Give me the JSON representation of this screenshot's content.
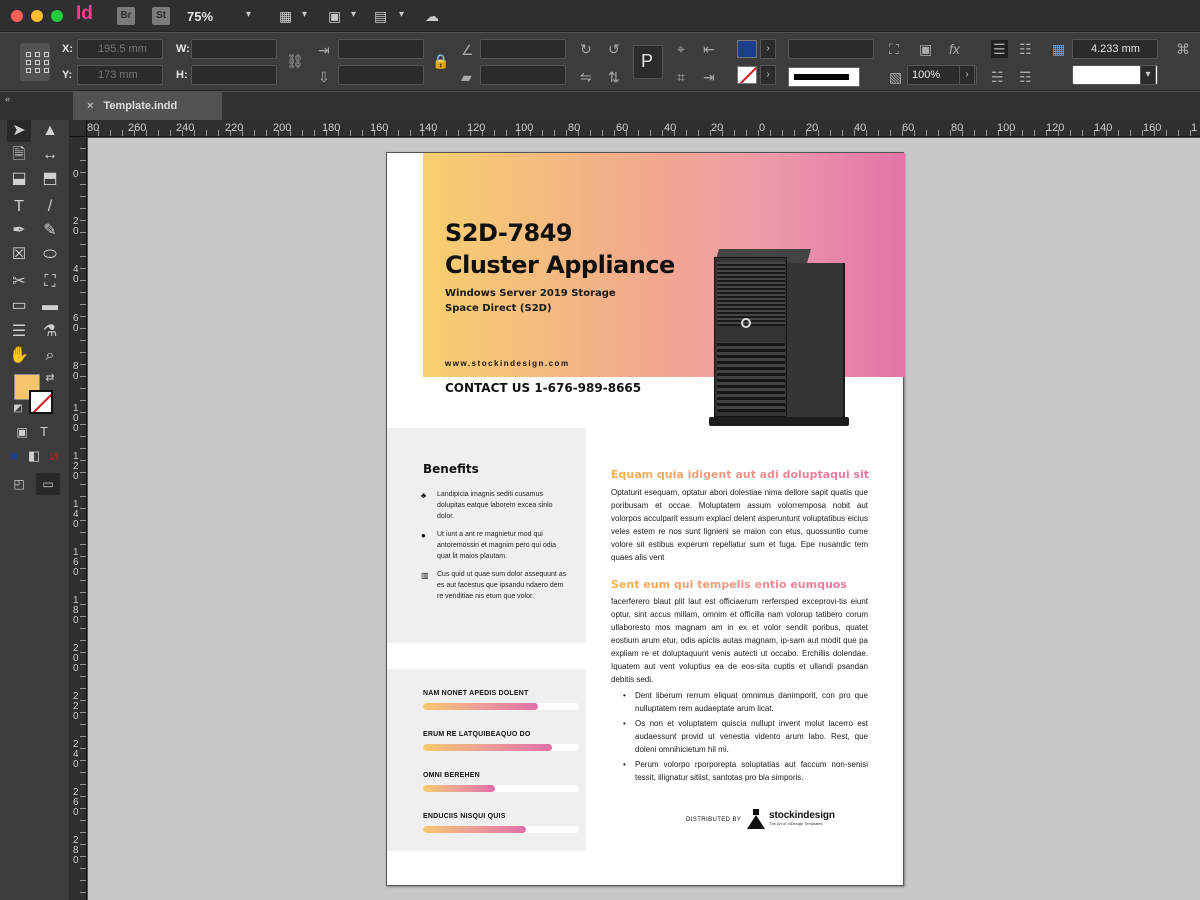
{
  "app": {
    "logo": "Id",
    "bridge": "Br",
    "stock": "St",
    "zoom": "75%"
  },
  "colors": {
    "fill": "#f4c56a",
    "accent_pink": "#e374a7",
    "accent_yellow": "#f7d06f",
    "ink": "#111111"
  },
  "control_panel": {
    "x_label": "X:",
    "y_label": "Y:",
    "w_label": "W:",
    "h_label": "H:",
    "x_value": "195.5 mm",
    "y_value": "173 mm",
    "opacity_value": "100%",
    "stroke_weight": "4.233 mm"
  },
  "tab": {
    "close": "×",
    "name": "Template.indd"
  },
  "ruler": {
    "top": [
      "80",
      "260",
      "240",
      "220",
      "200",
      "180",
      "160",
      "140",
      "120",
      "100",
      "80",
      "60",
      "40",
      "20",
      "0",
      "20",
      "40",
      "60",
      "80",
      "100",
      "120",
      "140",
      "160",
      "1"
    ],
    "left": [
      "0",
      "20",
      "40",
      "60",
      "80",
      "100",
      "120",
      "140",
      "160",
      "180",
      "200",
      "220",
      "240",
      "260",
      "280"
    ]
  },
  "document": {
    "title_line1": "S2D-7849",
    "title_line2": "Cluster Appliance",
    "subtitle_line1": "Windows Server 2019 Storage",
    "subtitle_line2": "Space Direct (S2D)",
    "website": "www.stockindesign.com",
    "contact": "CONTACT US 1-676-989-8665",
    "benefits_title": "Benefits",
    "benefits": [
      {
        "icon": "♣",
        "text": "Landipicia imagnis sediti cusamus dolupitas eatque laborem excea sinlo dolor."
      },
      {
        "icon": "●",
        "text": "Ut iunt a ant re magnietur mod qui antoremossin et magnim pero qui odia quat lit maios plautam."
      },
      {
        "icon": "▥",
        "text": "Cus quid ut quae sum dolor assequunt as es aut facestus que ipsandu ndaero dem re venditiae nis etum que volor."
      }
    ],
    "metrics": [
      {
        "label": "NAM NONET APEDIS DOLENT",
        "value": 0.74
      },
      {
        "label": "ERUM RE LATQUIBEAQUO DO",
        "value": 0.83
      },
      {
        "label": "OMNI BEREHEN",
        "value": 0.46
      },
      {
        "label": "ENDUCIIS NISQUI QUIS",
        "value": 0.66
      }
    ],
    "heading1": "Equam quia idigent aut adi doluptaqui sit",
    "paragraph1": "Optaturit esequam, optatur abori dolestiae nima dellore sapit quatis que poribusam et occae. Moluptatem assum volorremposa nobit aut volorpos acculparit essum explaci delent asperuntunt voluptatibus eicius veles estem re nos sunt lignieni se maion con etus, quossuntio cume volore sit estibus experum repellatur sum et fuga. Epe nusandic tem quaes alis vent",
    "heading2": "Sent eum qui tempelis entio eumquos",
    "paragraph2": "facerferero blaut plit laut est officiaerum rerfersped exceprovi-tis eiunt optur, sint accus millam, omnim et officilla nam volorup tatibero corum ullaboresto mos magnam am in ex et volor sendit poribus, quatet eostium arum etur, odis apiciis autas magnam, ip-sam aut modit que pa expliam re et doluptaquunt venis autecti ut occabo. Erchillis dolendae. Iquatem aut vent voluptius ea de eos-sita cuptis et ullandi psandan debitis sedi.",
    "bullets": [
      "Dent liberum rerrum eliquat omnimus danimporit, con pro que nulluptatem rem audaeptate arum licat.",
      "Os non et voluptatem quiscia nullupt invent molut lacerro est audaessunt provid ut venestia vidento arum labo. Rest, que doleni omnihicietum hil mi.",
      "Perum volorpo rporporepta soluptatias aut faccum non-senisi tessit, illignatur sitiist, santotas pro bla simporis."
    ],
    "distributed_by": "DISTRIBUTED BY",
    "logo_name": "stockindesign",
    "logo_tagline": "The Art of InDesign Templates"
  }
}
